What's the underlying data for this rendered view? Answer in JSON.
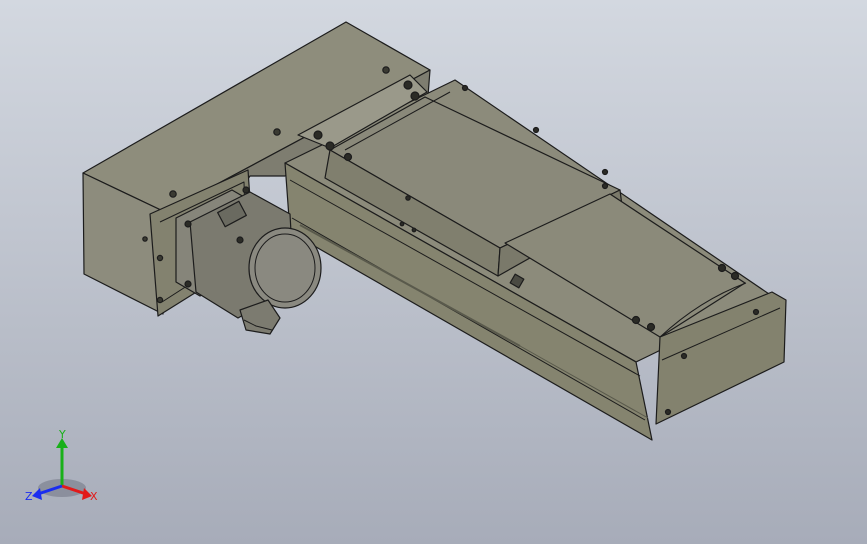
{
  "viewport": {
    "background_top": "#d3d8e0",
    "background_bottom": "#a7acb9"
  },
  "model": {
    "body_color": "#8e8d7e",
    "edge_color": "#1c1c1c",
    "parts": [
      "motor-mount-block",
      "servo-motor",
      "linear-rail-body",
      "slide-carriage",
      "end-cap"
    ]
  },
  "triad": {
    "x_label": "X",
    "y_label": "Y",
    "z_label": "Z",
    "x_color": "#e21a1a",
    "y_color": "#19b019",
    "z_color": "#1a2cf0"
  }
}
